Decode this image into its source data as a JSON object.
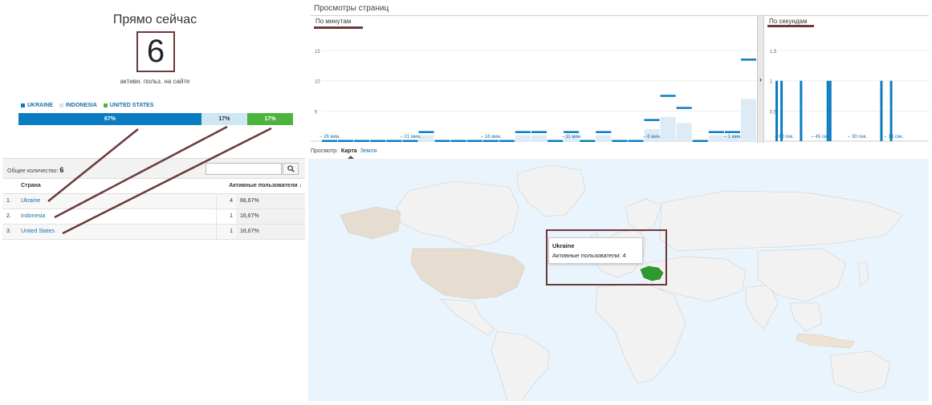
{
  "now": {
    "title": "Прямо сейчас",
    "count": "6",
    "subtitle": "активн. польз. на сайте"
  },
  "legend": [
    {
      "label": "UKRAINE",
      "color": "#0b7cc1"
    },
    {
      "label": "INDONESIA",
      "color": "#cfe6f3"
    },
    {
      "label": "UNITED STATES",
      "color": "#4cb43c"
    }
  ],
  "share_bar": [
    {
      "label": "67%",
      "fraction": 0.667,
      "color": "#0b7cc1",
      "text_color": "#ffffff"
    },
    {
      "label": "17%",
      "fraction": 0.167,
      "color": "#cfe6f3",
      "text_color": "#333333"
    },
    {
      "label": "17%",
      "fraction": 0.167,
      "color": "#4cb43c",
      "text_color": "#ffffff"
    }
  ],
  "table": {
    "total_label": "Общее количество:",
    "total_value": "6",
    "search_placeholder": "",
    "header_country": "Страна",
    "header_users": "Активные пользователи ↓",
    "rows": [
      {
        "idx": "1.",
        "country": "Ukraine",
        "value": "4",
        "pct": "66,67%"
      },
      {
        "idx": "2.",
        "country": "Indonesia",
        "value": "1",
        "pct": "16,67%"
      },
      {
        "idx": "3.",
        "country": "United States",
        "value": "1",
        "pct": "16,67%"
      }
    ]
  },
  "pageviews": {
    "title": "Просмотры страниц",
    "tab_minutes": "По минутам",
    "tab_seconds": "По секундам",
    "divider_arrow": "›"
  },
  "chart_data": [
    {
      "type": "bar",
      "title": "",
      "xlabel": "",
      "ylabel": "",
      "ylim": [
        0,
        17
      ],
      "yticks": [
        "15",
        "10",
        "5"
      ],
      "ytick_values": [
        15,
        10,
        5
      ],
      "x_tick_labels": [
        "– 26 мин.",
        "– 21 мин.",
        "– 16 мин.",
        "– 11 мин.",
        "– 6 мин.",
        "– 1 мин."
      ],
      "x_tick_positions": [
        26,
        21,
        16,
        11,
        6,
        1
      ],
      "values": [
        0,
        0,
        0,
        0,
        0,
        0,
        0,
        0,
        0,
        0,
        0,
        1,
        0,
        0,
        0,
        0,
        1,
        1,
        0,
        0,
        1,
        0,
        1,
        0,
        0,
        2,
        4,
        3,
        0,
        1,
        7,
        1,
        1,
        1,
        0
      ],
      "minutes_ago": [
        30,
        29,
        28,
        27,
        26,
        25,
        24,
        23,
        22,
        21,
        20,
        19,
        18,
        17,
        16,
        15,
        14,
        13,
        12,
        11,
        10,
        9,
        8,
        7,
        6,
        5,
        4,
        3,
        2,
        1,
        0
      ],
      "series_values": [
        0,
        0,
        0,
        0,
        0,
        0,
        1,
        0,
        0,
        0,
        0,
        0,
        1,
        1,
        0,
        1,
        0,
        1,
        0,
        0,
        2,
        4,
        3,
        0,
        1,
        1,
        7
      ],
      "grid": true
    },
    {
      "type": "bar",
      "title": "",
      "xlabel": "",
      "ylabel": "",
      "ylim": [
        0,
        1.7
      ],
      "yticks": [
        "1,5",
        "1",
        "0,5"
      ],
      "ytick_values": [
        1.5,
        1,
        0.5
      ],
      "x_tick_labels": [
        "– 60 сек.",
        "– 45 сек.",
        "– 30 сек.",
        "– 15 сек."
      ],
      "x_tick_positions": [
        60,
        45,
        30,
        15
      ],
      "seconds_ago_with_view": [
        59,
        57,
        49,
        38,
        37,
        16,
        12
      ],
      "values": [
        1,
        1,
        1,
        1,
        1,
        1,
        1
      ],
      "grid": true
    }
  ],
  "view_switch": {
    "label": "Просмотр:",
    "map": "Карта",
    "earth": "Земля"
  },
  "map": {
    "tooltip_country": "Ukraine",
    "tooltip_metric": "Активные пользователи: 4",
    "highlight_colors": {
      "ukraine": "#2e9a2e",
      "united_states": "#e6dcd0",
      "indonesia": "#efe2d3"
    }
  }
}
